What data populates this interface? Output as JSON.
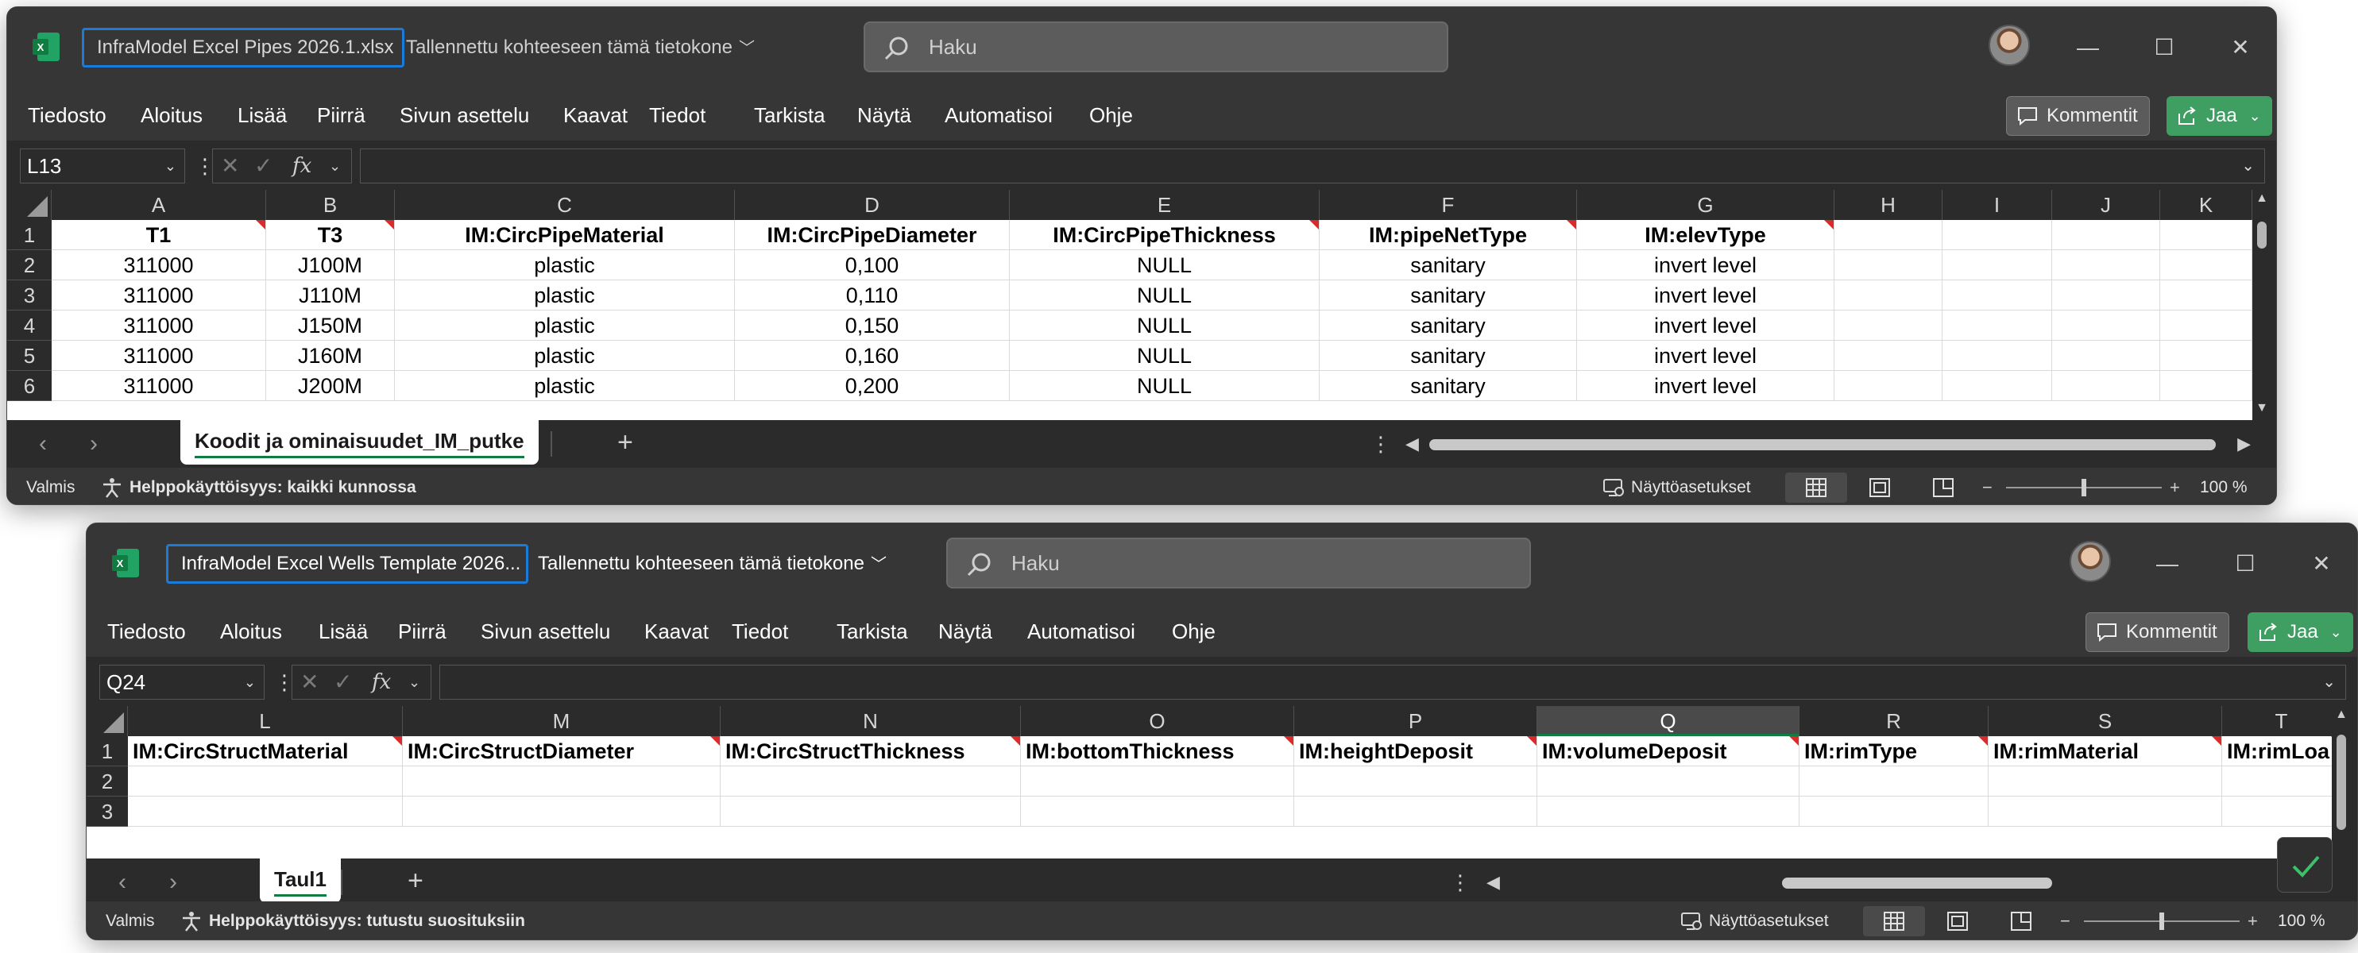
{
  "window1": {
    "filename": "InfraModel Excel Pipes 2026.1.xlsx",
    "saved_status": "Tallennettu kohteeseen tämä tietokone",
    "search_placeholder": "Haku",
    "menu": [
      "Tiedosto",
      "Aloitus",
      "Lisää",
      "Piirrä",
      "Sivun asettelu",
      "Kaavat",
      "Tiedot",
      "Tarkista",
      "Näytä",
      "Automatisoi",
      "Ohje"
    ],
    "comments_label": "Kommentit",
    "share_label": "Jaa",
    "name_box": "L13",
    "fx_label": "fx",
    "columns": [
      "A",
      "B",
      "C",
      "D",
      "E",
      "F",
      "G",
      "H",
      "I",
      "J",
      "K"
    ],
    "row_numbers": [
      "1",
      "2",
      "3",
      "4",
      "5",
      "6"
    ],
    "rows": [
      [
        "T1",
        "T3",
        "IM:CircPipeMaterial",
        "IM:CircPipeDiameter",
        "IM:CircPipeThickness",
        "IM:pipeNetType",
        "IM:elevType",
        "",
        "",
        "",
        ""
      ],
      [
        "311000",
        "J100M",
        "plastic",
        "0,100",
        "NULL",
        "sanitary",
        "invert level",
        "",
        "",
        "",
        ""
      ],
      [
        "311000",
        "J110M",
        "plastic",
        "0,110",
        "NULL",
        "sanitary",
        "invert level",
        "",
        "",
        "",
        ""
      ],
      [
        "311000",
        "J150M",
        "plastic",
        "0,150",
        "NULL",
        "sanitary",
        "invert level",
        "",
        "",
        "",
        ""
      ],
      [
        "311000",
        "J160M",
        "plastic",
        "0,160",
        "NULL",
        "sanitary",
        "invert level",
        "",
        "",
        "",
        ""
      ],
      [
        "311000",
        "J200M",
        "plastic",
        "0,200",
        "NULL",
        "sanitary",
        "invert level",
        "",
        "",
        "",
        ""
      ]
    ],
    "sheet_tab": "Koodit ja ominaisuudet_IM_putke",
    "status_ready": "Valmis",
    "accessibility": "Helppokäyttöisyys: kaikki kunnossa",
    "display_settings": "Näyttöasetukset",
    "zoom_label": "100 %",
    "zoom_level": 0.5
  },
  "window2": {
    "filename": "InfraModel Excel Wells Template 2026...",
    "saved_status": "Tallennettu kohteeseen tämä tietokone",
    "search_placeholder": "Haku",
    "menu": [
      "Tiedosto",
      "Aloitus",
      "Lisää",
      "Piirrä",
      "Sivun asettelu",
      "Kaavat",
      "Tiedot",
      "Tarkista",
      "Näytä",
      "Automatisoi",
      "Ohje"
    ],
    "comments_label": "Kommentit",
    "share_label": "Jaa",
    "name_box": "Q24",
    "fx_label": "fx",
    "columns": [
      "L",
      "M",
      "N",
      "O",
      "P",
      "Q",
      "R",
      "S",
      "T"
    ],
    "row_numbers": [
      "1",
      "2",
      "3"
    ],
    "rows": [
      [
        "IM:CircStructMaterial",
        "IM:CircStructDiameter",
        "IM:CircStructThickness",
        "IM:bottomThickness",
        "IM:heightDeposit",
        "IM:volumeDeposit",
        "IM:rimType",
        "IM:rimMaterial",
        "IM:rimLoa"
      ],
      [
        "",
        "",
        "",
        "",
        "",
        "",
        "",
        "",
        ""
      ],
      [
        "",
        "",
        "",
        "",
        "",
        "",
        "",
        "",
        ""
      ]
    ],
    "sheet_tab": "Taul1",
    "status_ready": "Valmis",
    "accessibility": "Helppokäyttöisyys: tutustu suosituksiin",
    "display_settings": "Näyttöasetukset",
    "zoom_label": "100 %",
    "zoom_level": 0.5
  },
  "colors": {
    "excel_green": "#107c41",
    "share_green": "#3f9f63",
    "focus_blue": "#1a7cd8",
    "note_red": "#d82c2c"
  }
}
